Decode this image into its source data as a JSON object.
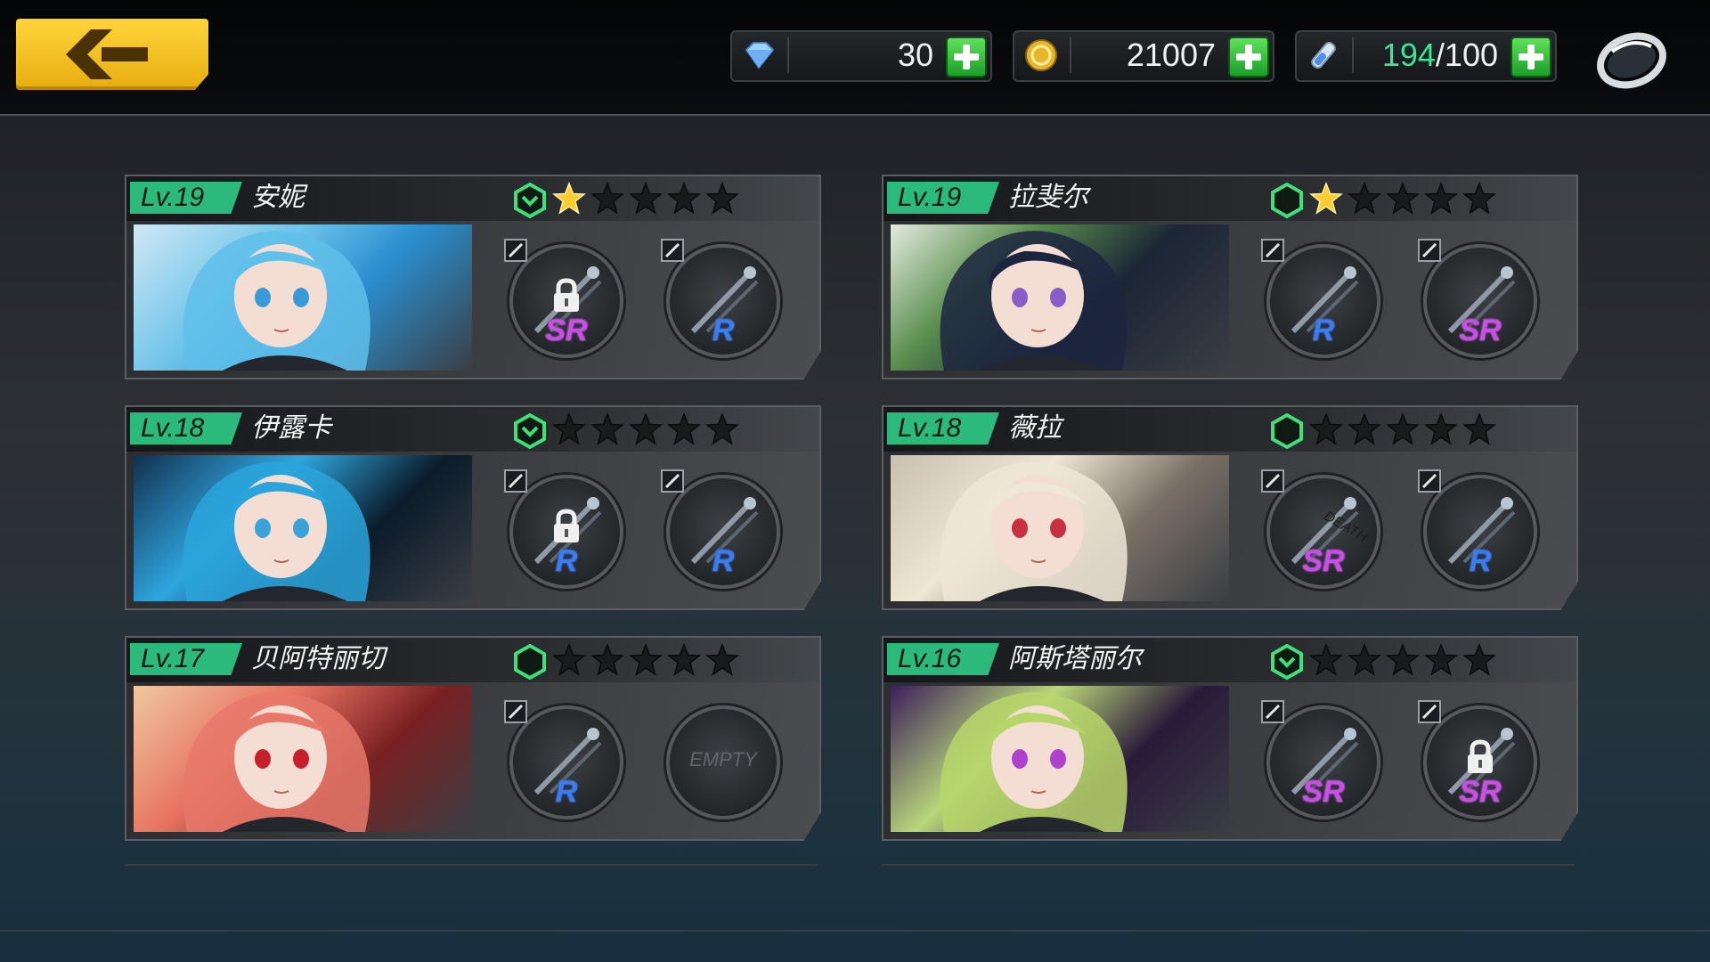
{
  "top_bar": {
    "back_icon": "back-arrow-icon",
    "resources": [
      {
        "icon": "gem-icon",
        "value": "30"
      },
      {
        "icon": "gold-coin-icon",
        "value": "21007"
      },
      {
        "icon": "stamina-potion-icon",
        "current": "194",
        "max": "/100"
      }
    ],
    "settings_icon": "ring-icon"
  },
  "characters": [
    {
      "level": "Lv.19",
      "name": "安妮",
      "rank_icon": "chevron-rank-icon",
      "stars": 1,
      "slots": [
        {
          "rarity": "SR",
          "locked": true,
          "icon": "mechanical-weapon-icon"
        },
        {
          "rarity": "R",
          "locked": false,
          "icon": "blue-staff-icon"
        }
      ]
    },
    {
      "level": "Lv.19",
      "name": "拉斐尔",
      "rank_icon": "hexagon-rank-icon",
      "stars": 1,
      "slots": [
        {
          "rarity": "R",
          "locked": false,
          "icon": "flower-wands-icon"
        },
        {
          "rarity": "SR",
          "locked": false,
          "icon": "green-chakram-icon"
        }
      ]
    },
    {
      "level": "Lv.18",
      "name": "伊露卡",
      "rank_icon": "chevron-rank-icon",
      "stars": 0,
      "slots": [
        {
          "rarity": "R",
          "locked": true,
          "icon": "twin-swords-icon"
        },
        {
          "rarity": "R",
          "locked": false,
          "icon": "crystal-swords-icon"
        }
      ]
    },
    {
      "level": "Lv.18",
      "name": "薇拉",
      "rank_icon": "hexagon-rank-icon",
      "stars": 0,
      "slots": [
        {
          "rarity": "SR",
          "locked": false,
          "icon": "death-battery-icon",
          "label": "DEATH"
        },
        {
          "rarity": "R",
          "locked": false,
          "icon": "cannon-icon"
        }
      ]
    },
    {
      "level": "Lv.17",
      "name": "贝阿特丽切",
      "rank_icon": "hexagon-rank-icon",
      "stars": 0,
      "slots": [
        {
          "rarity": "R",
          "locked": false,
          "icon": "rapier-icon"
        },
        {
          "empty": true,
          "label": "EMPTY"
        }
      ]
    },
    {
      "level": "Lv.16",
      "name": "阿斯塔丽尔",
      "rank_icon": "chevron-rank-icon",
      "stars": 0,
      "slots": [
        {
          "rarity": "SR",
          "locked": false,
          "icon": "purple-syringe-gun-icon"
        },
        {
          "rarity": "SR",
          "locked": true,
          "icon": "dark-blade-icon"
        }
      ]
    }
  ],
  "colors": {
    "level_badge": "#2bb97c",
    "plus_button": "#3dc244",
    "sr": "#c94fe6",
    "r": "#3a7cf2",
    "star_gold": "#ffcc33",
    "back_button": "#f5c123"
  }
}
